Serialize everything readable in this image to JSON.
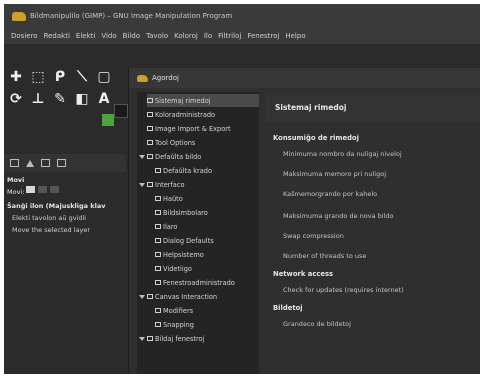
{
  "window": {
    "title": "Bildmanipulilo (GIMP) – GNU Image Manipulation Program"
  },
  "menubar": {
    "items": [
      "Dosiero",
      "Redakti",
      "Elekti",
      "Vido",
      "Bildo",
      "Tavolo",
      "Koloroj",
      "Ilo",
      "Filtriloj",
      "Fenestroj",
      "Helpo"
    ]
  },
  "toolbox": {
    "tool_icons": [
      "move-tool",
      "rect-select-tool",
      "lasso-tool",
      "path-tool",
      "crop-tool",
      "text-tool"
    ],
    "dock_title": "Movi",
    "mode_label": "Movi:",
    "option_title": "Ŝanĝi ilon (Majuskliga klav",
    "options": [
      "Elekti tavolon aŭ gvidli",
      "Move the selected layer"
    ],
    "fg_color": "#4fa33b",
    "bg_color": "#1a1a1a"
  },
  "dialog": {
    "title": "Agordoj"
  },
  "tree": {
    "items": [
      {
        "label": "Sistemaj rimedoj",
        "icon": "ram-icon",
        "selected": true
      },
      {
        "label": "Koloradministrado",
        "icon": "color-icon"
      },
      {
        "label": "Image Import & Export",
        "icon": "import-icon"
      },
      {
        "label": "Tool Options",
        "icon": "tool-icon"
      },
      {
        "label": "Defaŭlta bildo",
        "icon": "image-icon",
        "expandable": true
      },
      {
        "label": "Defaŭlta krado",
        "icon": "grid-icon"
      },
      {
        "label": "Interfaco",
        "icon": "interface-icon",
        "expandable": true
      },
      {
        "label": "Haŭto",
        "icon": "theme-icon"
      },
      {
        "label": "Bildsimbolaro",
        "icon": "icon-theme-icon"
      },
      {
        "label": "Ilaro",
        "icon": "toolbox-icon"
      },
      {
        "label": "Dialog Defaults",
        "icon": "dialog-icon"
      },
      {
        "label": "Helpsistemo",
        "icon": "help-icon"
      },
      {
        "label": "Videtiigo",
        "icon": "display-icon"
      },
      {
        "label": "Fenestroadministrado",
        "icon": "window-icon"
      },
      {
        "label": "Canvas Interaction",
        "icon": "canvas-icon",
        "expandable": true
      },
      {
        "label": "Modifiers",
        "icon": "modifiers-icon"
      },
      {
        "label": "Snapping",
        "icon": "snapping-icon"
      },
      {
        "label": "Bildaj fenestroj",
        "icon": "image-window-icon",
        "expandable": true
      }
    ]
  },
  "panel": {
    "title": "Sistemaj rimedoj",
    "section1": "Konsumiĝo de rimedoj",
    "rows1": [
      "Minimuma nombro da nuligaj niveloj",
      "Maksimuma memoro pri nuligoj",
      "Kaŝmemorgrando por kahelo",
      "Maksimuma grando de nova bildo",
      "Swap compression",
      "Number of threads to use"
    ],
    "section2": "Network access",
    "rows2": [
      "Check for updates (requires internet)"
    ],
    "section3": "Bildetoj",
    "rows3": [
      "Grandeco de bildetoj"
    ]
  }
}
